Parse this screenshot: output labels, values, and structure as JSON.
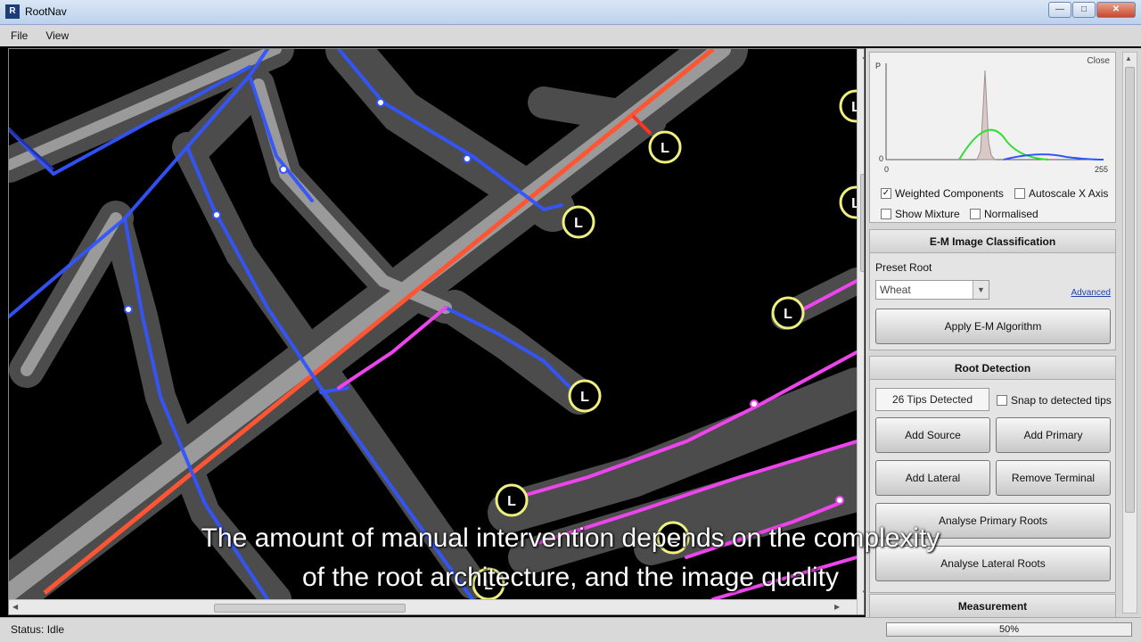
{
  "window": {
    "title": "RootNav",
    "minimize": "—",
    "maximize": "□",
    "close": "✕"
  },
  "menu": {
    "file": "File",
    "view": "View"
  },
  "histogram": {
    "close_label": "Close",
    "y_label": "P",
    "y_zero": "0",
    "x_min": "0",
    "x_max": "255",
    "weighted_components": "Weighted Components",
    "autoscale_x": "Autoscale X Axis",
    "show_mixture": "Show Mixture",
    "normalised": "Normalised",
    "weighted_checked": true
  },
  "em_section": {
    "title": "E-M Image Classification",
    "preset_label": "Preset Root",
    "preset_value": "Wheat",
    "advanced": "Advanced",
    "apply_button": "Apply E-M Algorithm"
  },
  "root_detection": {
    "title": "Root Detection",
    "tips_detected": "26 Tips Detected",
    "snap_label": "Snap to detected tips",
    "add_source": "Add Source",
    "add_primary": "Add Primary",
    "add_lateral": "Add Lateral",
    "remove_terminal": "Remove Terminal",
    "analyse_primary": "Analyse Primary Roots",
    "analyse_lateral": "Analyse Lateral Roots"
  },
  "measurement": {
    "title": "Measurement"
  },
  "status": {
    "text": "Status: Idle",
    "progress_label": "50%",
    "progress": 0.5
  },
  "markers": {
    "lateral_label": "L"
  },
  "subtitles": {
    "line1": "The amount of manual intervention depends on the complexity",
    "line2": "of the root architecture, and the image quality"
  },
  "colors": {
    "primary_root": "#ff5533",
    "lateral_blue": "#3355ff",
    "lateral_magenta": "#ee44ee",
    "tip_marker": "#f0f080"
  }
}
